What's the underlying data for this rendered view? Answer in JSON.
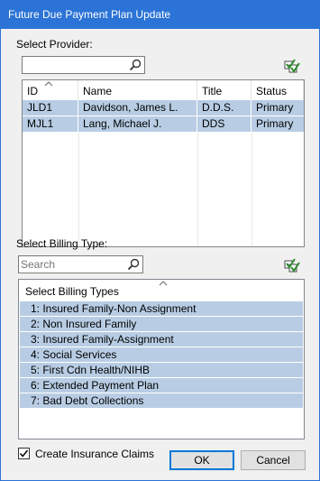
{
  "window": {
    "title": "Future Due Payment Plan Update"
  },
  "provider": {
    "label": "Select Provider:",
    "search_value": "",
    "columns": [
      "ID",
      "Name",
      "Title",
      "Status"
    ],
    "rows": [
      {
        "id": "JLD1",
        "name": "Davidson, James L.",
        "title": "D.D.S.",
        "status": "Primary"
      },
      {
        "id": "MJL1",
        "name": "Lang, Michael J.",
        "title": "DDS",
        "status": "Primary"
      }
    ]
  },
  "billing": {
    "label": "Select Billing Type:",
    "search_placeholder": "Search",
    "list_header": "Select Billing Types",
    "items": [
      "1: Insured Family-Non Assignment",
      "2: Non Insured Family",
      "3: Insured Family-Assignment",
      "4: Social Services",
      "5: First Cdn Health/NIHB",
      "6: Extended Payment Plan",
      "7: Bad Debt Collections"
    ]
  },
  "footer": {
    "create_claims_label": "Create Insurance Claims",
    "create_claims_checked": true,
    "ok_label": "OK",
    "cancel_label": "Cancel"
  },
  "colors": {
    "titlebar": "#2b73d6",
    "selection": "#b8cde4"
  },
  "icons": [
    "search-icon",
    "select-all-check-icon",
    "sort-up-icon",
    "checkmark-icon"
  ]
}
